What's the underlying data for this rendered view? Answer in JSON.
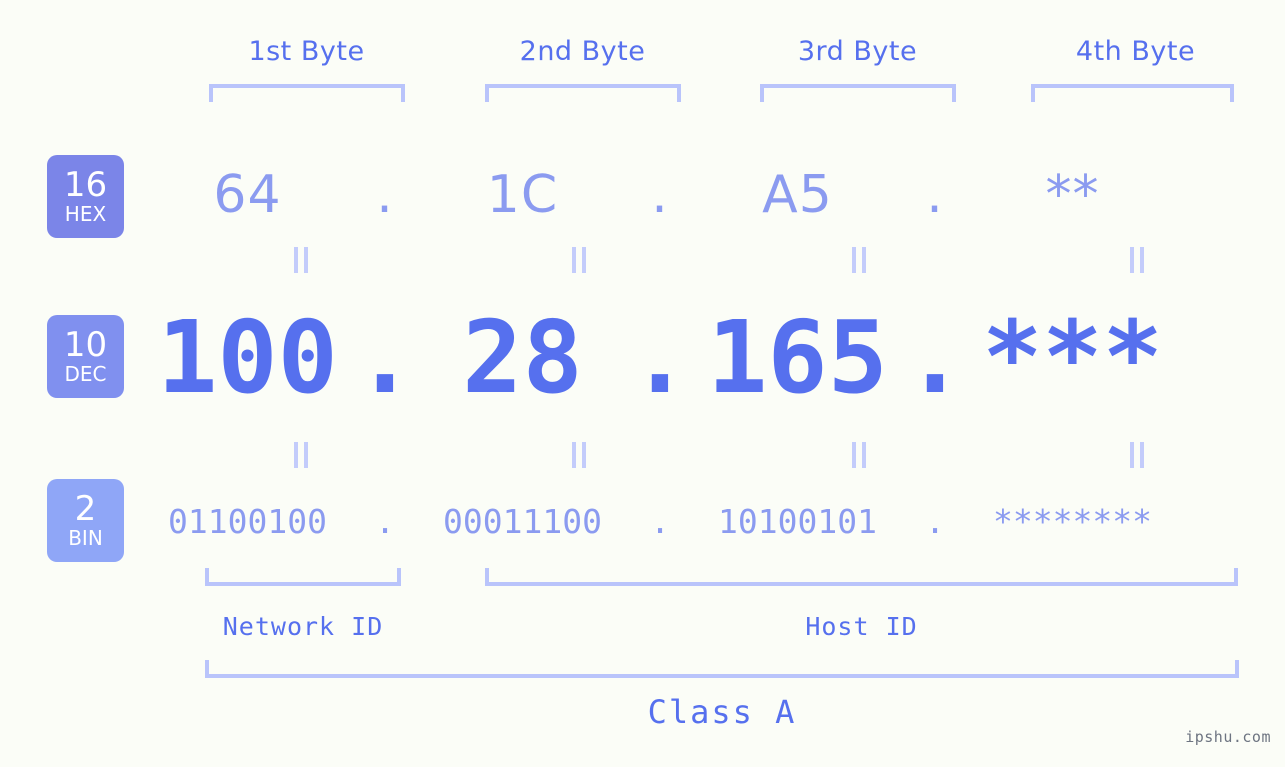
{
  "background_color": "#fbfdf7",
  "accent_color": "#5670ee",
  "muted_color": "#8b9bf0",
  "bracket_color": "#b9c4fb",
  "byte_headers": [
    {
      "label": "1st Byte"
    },
    {
      "label": "2nd Byte"
    },
    {
      "label": "3rd Byte"
    },
    {
      "label": "4th Byte"
    }
  ],
  "rows": {
    "hex": {
      "badge_number": "16",
      "badge_name": "HEX",
      "badge_color": "#7b85e8",
      "values": [
        "64",
        "1C",
        "A5",
        "**"
      ],
      "separators": [
        ".",
        ".",
        "."
      ]
    },
    "dec": {
      "badge_number": "10",
      "badge_name": "DEC",
      "badge_color": "#8090ef",
      "values": [
        "100",
        "28",
        "165",
        "***"
      ],
      "separators": [
        ".",
        ".",
        "."
      ]
    },
    "bin": {
      "badge_number": "2",
      "badge_name": "BIN",
      "badge_color": "#8fa6f7",
      "values": [
        "01100100",
        "00011100",
        "10100101",
        "********"
      ],
      "separators": [
        ".",
        ".",
        "."
      ]
    }
  },
  "equals_separator_glyph": "=",
  "id_sections": [
    {
      "label": "Network ID"
    },
    {
      "label": "Host ID"
    }
  ],
  "class_label": "Class A",
  "watermark": "ipshu.com"
}
